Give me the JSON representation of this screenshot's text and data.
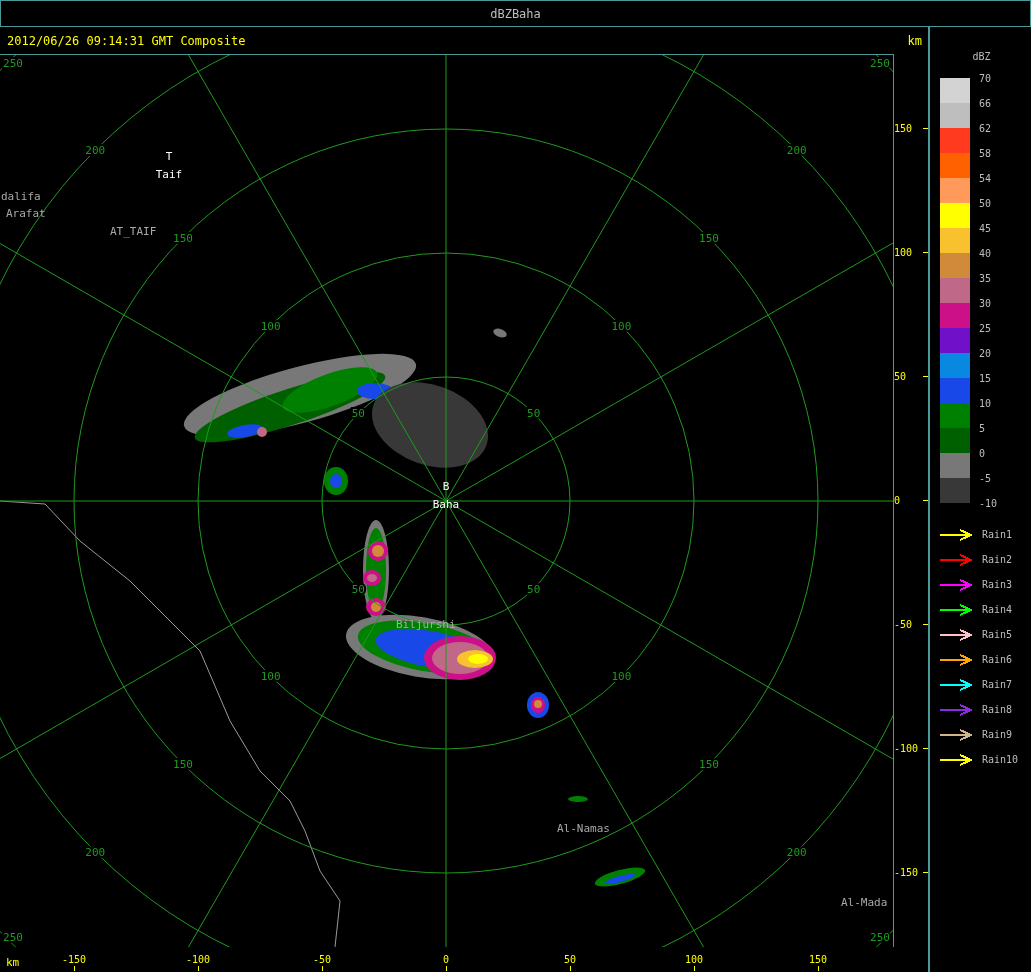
{
  "window": {
    "title": "dBZBaha"
  },
  "header": {
    "timestamp": "2012/06/26 09:14:31 GMT Composite",
    "unit": "km"
  },
  "plot": {
    "range_rings": [
      {
        "labels": [
          "50",
          "50",
          "50",
          "50"
        ]
      },
      {
        "labels": [
          "100",
          "100",
          "100",
          "100"
        ]
      },
      {
        "labels": [
          "150",
          "150",
          "150",
          "150"
        ]
      },
      {
        "labels": [
          "200",
          "200",
          "200",
          "200"
        ]
      },
      {
        "labels": [
          "250",
          "250",
          "250",
          "250"
        ]
      }
    ],
    "places": [
      {
        "kind": "station",
        "marker": "T",
        "name": "Taif"
      },
      {
        "kind": "town",
        "name": "dalifa"
      },
      {
        "kind": "town",
        "name": "Arafat"
      },
      {
        "kind": "town",
        "name": "AT_TAIF"
      },
      {
        "kind": "station",
        "marker": "B",
        "name": "Baha"
      },
      {
        "kind": "town",
        "name": "Biljurshi"
      },
      {
        "kind": "town",
        "name": "Al-Namas"
      },
      {
        "kind": "town",
        "name": "Al-Mada"
      }
    ]
  },
  "y_axis": {
    "ticks": [
      "150",
      "100",
      "50",
      "0",
      "-50",
      "-100",
      "-150"
    ]
  },
  "x_axis": {
    "unit": "km",
    "ticks": [
      "-150",
      "-100",
      "-50",
      "0",
      "50",
      "100",
      "150"
    ]
  },
  "legend": {
    "unit": "dBZ",
    "labels": [
      "70",
      "66",
      "62",
      "58",
      "54",
      "50",
      "45",
      "40",
      "35",
      "30",
      "25",
      "20",
      "15",
      "10",
      "5",
      "0",
      "-5",
      "-10"
    ],
    "bands": [
      {
        "color": "#d3d3d3"
      },
      {
        "color": "#bebebe"
      },
      {
        "color": "#ff3a1e"
      },
      {
        "color": "#ff6000"
      },
      {
        "color": "#ff9a5a"
      },
      {
        "color": "#ffff00"
      },
      {
        "color": "#f8c12e"
      },
      {
        "color": "#d08a3a"
      },
      {
        "color": "#c06888"
      },
      {
        "color": "#cc1088"
      },
      {
        "color": "#7010c8"
      },
      {
        "color": "#0888e0"
      },
      {
        "color": "#1848e8"
      },
      {
        "color": "#008000"
      },
      {
        "color": "#006000"
      },
      {
        "color": "#787878"
      },
      {
        "color": "#383838"
      }
    ]
  },
  "rain_legend": [
    {
      "label": "Rain1",
      "color": "#ffff00"
    },
    {
      "label": "Rain2",
      "color": "#ff0000"
    },
    {
      "label": "Rain3",
      "color": "#ff00ff"
    },
    {
      "label": "Rain4",
      "color": "#00ff00"
    },
    {
      "label": "Rain5",
      "color": "#ffc0cb"
    },
    {
      "label": "Rain6",
      "color": "#ffa500"
    },
    {
      "label": "Rain7",
      "color": "#00ffff"
    },
    {
      "label": "Rain8",
      "color": "#8a2be2"
    },
    {
      "label": "Rain9",
      "color": "#d2b48c"
    },
    {
      "label": "Rain10",
      "color": "#ffff00"
    }
  ]
}
